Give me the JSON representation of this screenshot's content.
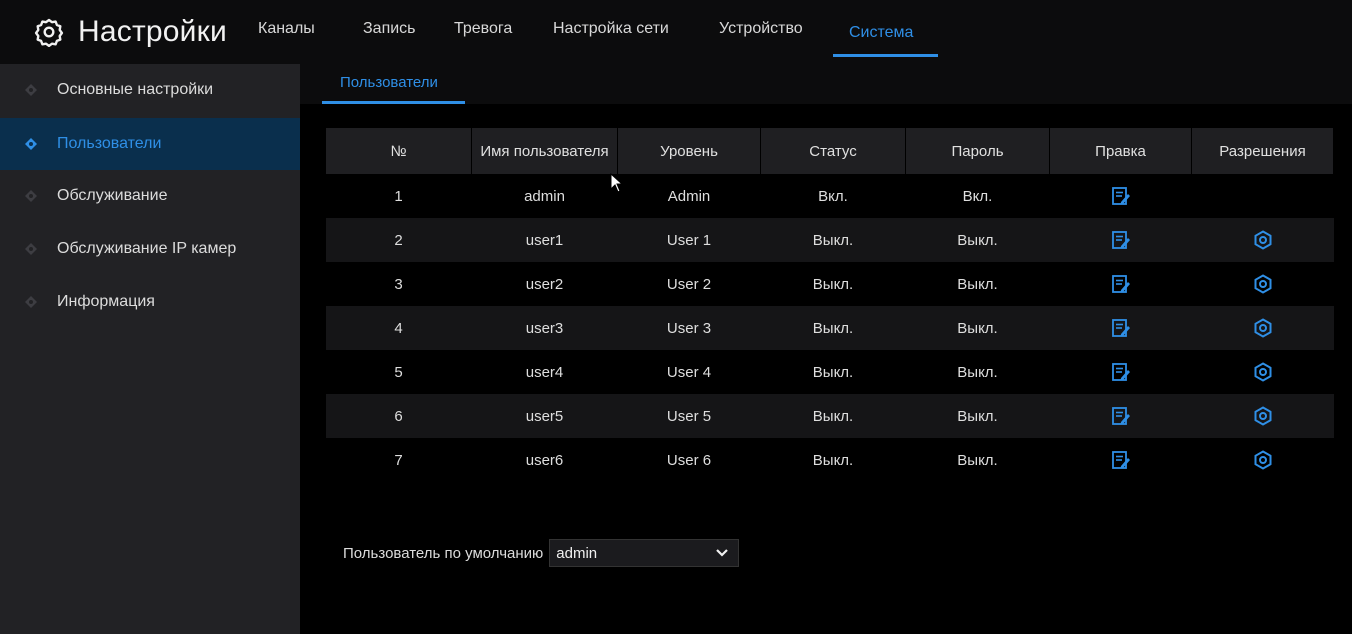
{
  "header": {
    "title": "Настройки",
    "icon": "gear-icon",
    "tabs": [
      {
        "label": "Каналы",
        "active": false
      },
      {
        "label": "Запись",
        "active": false
      },
      {
        "label": "Тревога",
        "active": false
      },
      {
        "label": "Настройка сети",
        "active": false
      },
      {
        "label": "Устройство",
        "active": false
      },
      {
        "label": "Система",
        "active": true
      }
    ]
  },
  "sidebar": {
    "items": [
      {
        "label": "Основные настройки",
        "active": false
      },
      {
        "label": "Пользователи",
        "active": true
      },
      {
        "label": "Обслуживание",
        "active": false
      },
      {
        "label": "Обслуживание IP камер",
        "active": false
      },
      {
        "label": "Информация",
        "active": false
      }
    ]
  },
  "main": {
    "subtab": "Пользователи",
    "table": {
      "columns": [
        "№",
        "Имя пользователя",
        "Уровень",
        "Статус",
        "Пароль",
        "Правка",
        "Разрешения"
      ],
      "rows": [
        {
          "no": "1",
          "user": "admin",
          "level": "Admin",
          "status": "Вкл.",
          "password": "Вкл.",
          "edit": true,
          "perm": false
        },
        {
          "no": "2",
          "user": "user1",
          "level": "User 1",
          "status": "Выкл.",
          "password": "Выкл.",
          "edit": true,
          "perm": true
        },
        {
          "no": "3",
          "user": "user2",
          "level": "User 2",
          "status": "Выкл.",
          "password": "Выкл.",
          "edit": true,
          "perm": true
        },
        {
          "no": "4",
          "user": "user3",
          "level": "User 3",
          "status": "Выкл.",
          "password": "Выкл.",
          "edit": true,
          "perm": true
        },
        {
          "no": "5",
          "user": "user4",
          "level": "User 4",
          "status": "Выкл.",
          "password": "Выкл.",
          "edit": true,
          "perm": true
        },
        {
          "no": "6",
          "user": "user5",
          "level": "User 5",
          "status": "Выкл.",
          "password": "Выкл.",
          "edit": true,
          "perm": true
        },
        {
          "no": "7",
          "user": "user6",
          "level": "User 6",
          "status": "Выкл.",
          "password": "Выкл.",
          "edit": true,
          "perm": true
        }
      ]
    },
    "default_user": {
      "label": "Пользователь по умолчанию",
      "value": "admin"
    }
  },
  "colors": {
    "accent": "#2f8fe6",
    "sidebar_bg": "#222225",
    "active_item_bg": "#0a2f4d",
    "header_bg": "#0c0c0d"
  }
}
